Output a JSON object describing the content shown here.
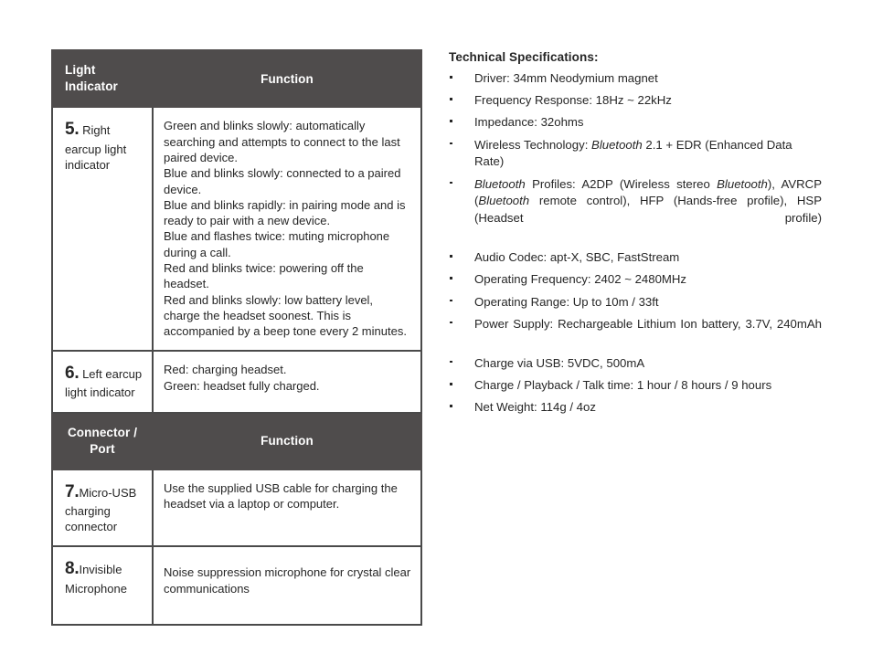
{
  "table": {
    "header_light": {
      "col1": "Light\nIndicator",
      "col1_line1": "Light",
      "col1_line2": "Indicator",
      "col2": "Function"
    },
    "header_connector": {
      "col1_line1": "Connector /",
      "col1_line2": "Port",
      "col2": "Function"
    },
    "rows": [
      {
        "number": "5.",
        "item": " Right earcup light indicator",
        "lines": [
          "Green and blinks slowly: automatically searching and attempts to connect to the last paired device.",
          "Blue and blinks slowly: connected to a paired device.",
          "Blue and blinks rapidly: in pairing mode and is ready to pair with a new device.",
          "Blue and flashes twice: muting microphone during a call.",
          "Red and blinks twice: powering off the headset.",
          "Red and blinks slowly: low battery level, charge the headset soonest. This is accompanied by a beep tone every 2 minutes."
        ]
      },
      {
        "number": "6.",
        "item": " Left earcup light indicator",
        "lines": [
          "Red: charging headset.",
          "Green: headset fully charged."
        ]
      },
      {
        "number": "7.",
        "item": "Micro-USB charging connector",
        "lines": [
          "Use the supplied USB cable for charging the headset via a laptop or computer."
        ]
      },
      {
        "number": "8.",
        "item": "Invisible Microphone",
        "lines": [
          "Noise suppression microphone for crystal clear communications"
        ]
      }
    ]
  },
  "specs": {
    "title": "Technical Specifications:",
    "items": [
      {
        "text": "Driver: 34mm Neodymium magnet"
      },
      {
        "text": "Frequency Response: 18Hz ~ 22kHz"
      },
      {
        "text": "Impedance: 32ohms"
      },
      {
        "text": "Wireless Technology: Bluetooth 2.1 + EDR (Enhanced Data Rate)"
      },
      {
        "text": "Bluetooth Profiles: A2DP (Wireless stereo Bluetooth), AVRCP (Bluetooth remote control), HFP (Hands-free profile), HSP (Headset profile)"
      },
      {
        "text": "Audio Codec: apt-X, SBC, FastStream"
      },
      {
        "text": "Operating Frequency: 2402 ~ 2480MHz"
      },
      {
        "text": "Operating Range: Up to 10m / 33ft"
      },
      {
        "text": "Power Supply: Rechargeable Lithium Ion battery, 3.7V, 240mAh"
      },
      {
        "text": "Charge via USB: 5VDC, 500mA"
      },
      {
        "text": "Charge / Playback / Talk time: 1 hour / 8 hours / 9 hours"
      },
      {
        "text": "Net Weight: 114g / 4oz"
      }
    ]
  },
  "colors": {
    "band_background": "#4f4c4c",
    "border": "#4a4a4a",
    "text": "#262626",
    "band_text": "#ffffff"
  }
}
